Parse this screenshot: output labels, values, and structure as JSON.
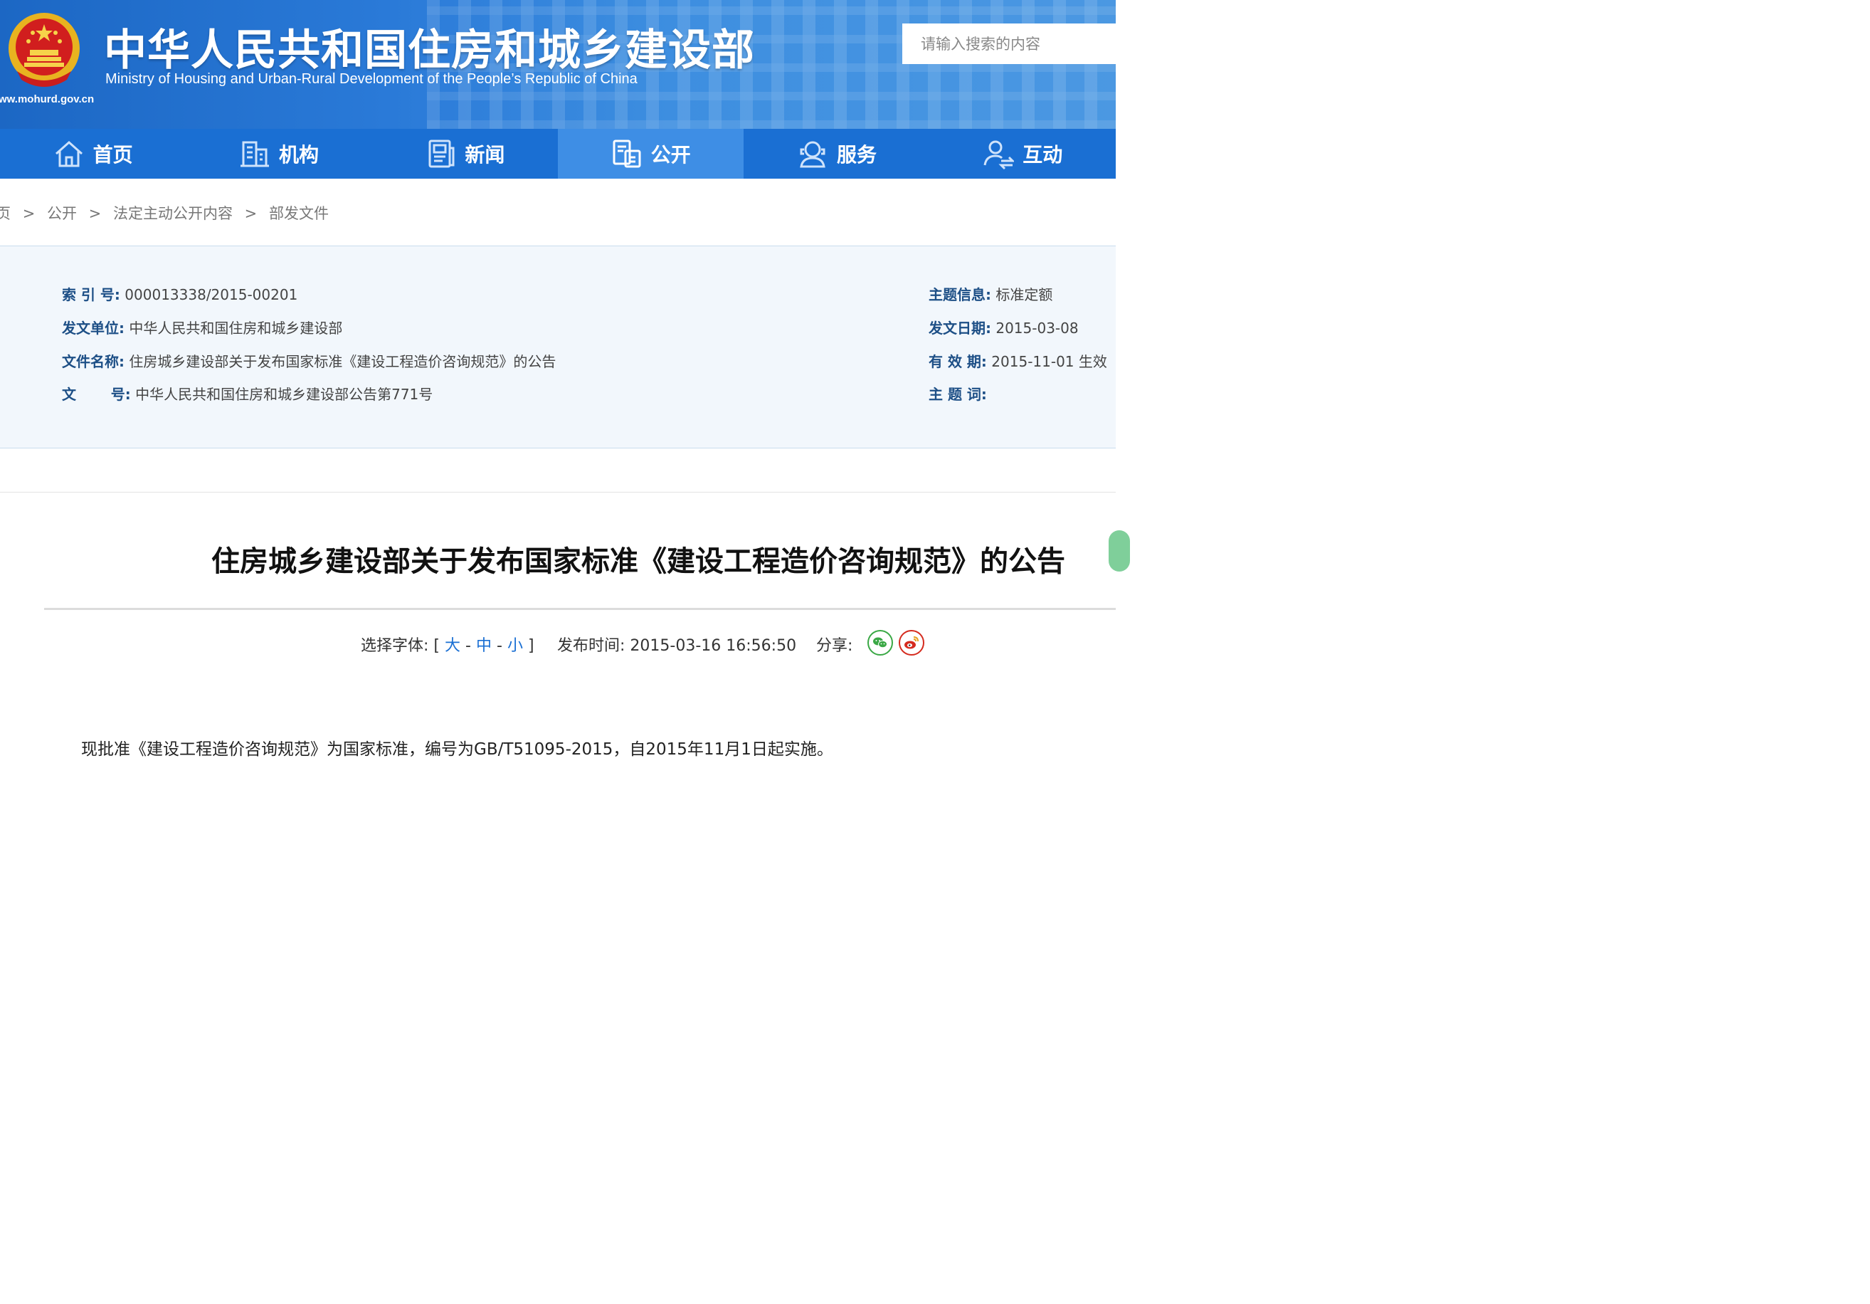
{
  "header": {
    "title": "中华人民共和国住房和城乡建设部",
    "subtitle": "Ministry of Housing and Urban-Rural Development of the People’s Republic of China",
    "url": "ww.mohurd.gov.cn",
    "search_placeholder": "请输入搜索的内容"
  },
  "nav": [
    {
      "label": "首页",
      "icon": "home-icon"
    },
    {
      "label": "机构",
      "icon": "building-icon"
    },
    {
      "label": "新闻",
      "icon": "news-icon"
    },
    {
      "label": "公开",
      "icon": "disclosure-icon",
      "active": true
    },
    {
      "label": "服务",
      "icon": "service-icon"
    },
    {
      "label": "互动",
      "icon": "interact-icon"
    }
  ],
  "breadcrumb": [
    "页",
    "公开",
    "法定主动公开内容",
    "部发文件"
  ],
  "breadcrumb_sep": ">",
  "meta": {
    "index_label": "索 引 号:",
    "index_value": "000013338/2015-00201",
    "issuer_label": "发文单位:",
    "issuer_value": "中华人民共和国住房和城乡建设部",
    "docname_label": "文件名称:",
    "docname_value": "住房城乡建设部关于发布国家标准《建设工程造价咨询规范》的公告",
    "docno_label": "文       号:",
    "docno_value": "中华人民共和国住房和城乡建设部公告第771号",
    "topic_label": "主题信息:",
    "topic_value": "标准定额",
    "date_label": "发文日期:",
    "date_value": "2015-03-08",
    "valid_label": "有 效 期:",
    "valid_value": "2015-11-01 生效",
    "keywords_label": "主 题 词:",
    "keywords_value": ""
  },
  "article": {
    "title": "住房城乡建设部关于发布国家标准《建设工程造价咨询规范》的公告",
    "font_label": "选择字体:",
    "font_open": "[",
    "font_large": "大",
    "font_dash1": "-",
    "font_medium": "中",
    "font_dash2": "-",
    "font_small": "小",
    "font_close": "]",
    "publish_label": "发布时间:",
    "publish_time": "2015-03-16 16:56:50",
    "share_label": "分享:",
    "body": "现批准《建设工程造价咨询规范》为国家标准，编号为GB/T51095-2015，自2015年11月1日起实施。"
  },
  "colors": {
    "nav_bg": "#1a6fd3",
    "nav_active": "#3e8ee5",
    "wechat": "#3aa845",
    "weibo": "#d52b1e"
  }
}
